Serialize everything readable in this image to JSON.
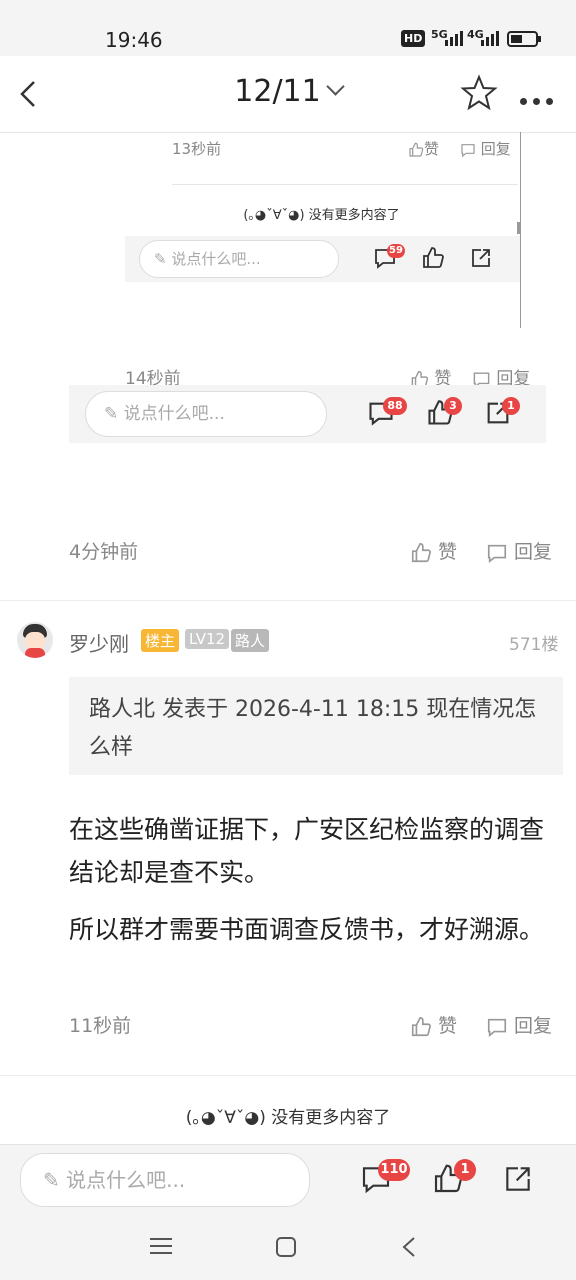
{
  "status": {
    "time": "19:46",
    "hd": "HD",
    "net1": "5G",
    "net2": "4G"
  },
  "nav": {
    "title": "12/11"
  },
  "nested_preview": {
    "time": "13秒前",
    "like": "赞",
    "reply": "回复",
    "end_text": "(｡◕ˇ∀ˇ◕) 没有更多内容了",
    "placeholder": "说点什么吧...",
    "comment_count": "59"
  },
  "mid_preview": {
    "time": "14秒前",
    "like": "赞",
    "reply": "回复",
    "placeholder": "说点什么吧...",
    "comment_count": "88",
    "like_count": "3",
    "share_count": "1"
  },
  "prev_post": {
    "time": "4分钟前",
    "like": "赞",
    "reply": "回复"
  },
  "post": {
    "author": "罗少刚",
    "tag_owner": "楼主",
    "tag_level": "LV12",
    "tag_role": "路人",
    "floor": "571楼",
    "quote": "路人北 发表于 2026-4-11 18:15 现在情况怎么样",
    "para1": "在这些确凿证据下，广安区纪检监察的调查结论却是查不实。",
    "para2": "所以群才需要书面调查反馈书，才好溯源。",
    "time": "11秒前",
    "like": "赞",
    "reply": "回复"
  },
  "end_text": "(｡◕ˇ∀ˇ◕) 没有更多内容了",
  "bottom_bar": {
    "placeholder": "说点什么吧...",
    "comment_count": "110",
    "like_count": "1"
  }
}
